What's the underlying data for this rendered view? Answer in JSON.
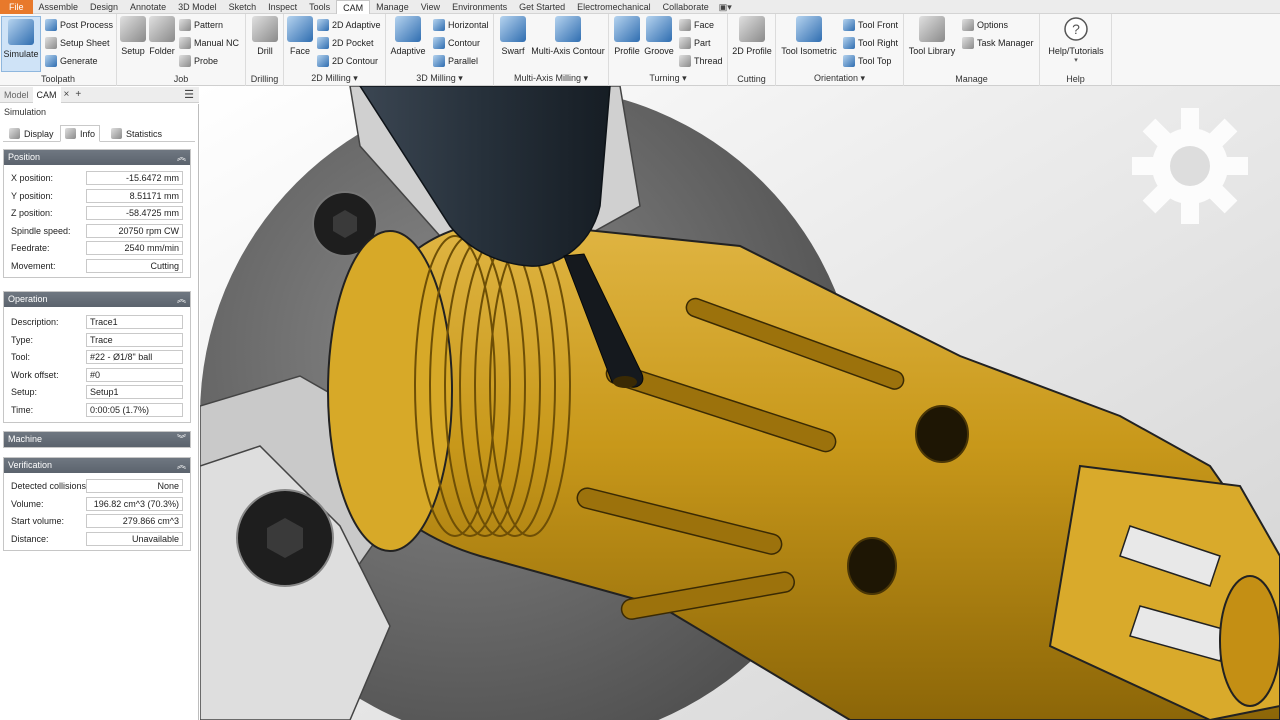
{
  "menu_tabs": [
    "File",
    "Assemble",
    "Design",
    "Annotate",
    "3D Model",
    "Sketch",
    "Inspect",
    "Tools",
    "CAM",
    "Manage",
    "View",
    "Environments",
    "Get Started",
    "Electromechanical",
    "Collaborate"
  ],
  "ribbon": {
    "toolpath": {
      "title": "Toolpath",
      "simulate": "Simulate",
      "post_process": "Post Process",
      "setup_sheet": "Setup Sheet",
      "generate": "Generate"
    },
    "job": {
      "title": "Job",
      "setup": "Setup",
      "folder": "Folder",
      "pattern": "Pattern",
      "manual_nc": "Manual NC",
      "probe": "Probe"
    },
    "drilling": {
      "title": "Drilling",
      "drill": "Drill"
    },
    "milling_2d": {
      "title": "2D Milling",
      "face": "Face",
      "adaptive": "2D Adaptive",
      "pocket": "2D Pocket",
      "contour": "2D Contour"
    },
    "milling_3d": {
      "title": "3D Milling",
      "adaptive": "Adaptive",
      "horizontal": "Horizontal",
      "contour": "Contour",
      "parallel": "Parallel"
    },
    "multi_axis": {
      "title": "Multi-Axis Milling",
      "swarf": "Swarf",
      "multi_axis_contour": "Multi-Axis Contour"
    },
    "turning": {
      "title": "Turning",
      "profile": "Profile",
      "groove": "Groove",
      "face": "Face",
      "part": "Part",
      "thread": "Thread"
    },
    "cutting": {
      "title": "Cutting",
      "profile_2d": "2D Profile"
    },
    "orientation": {
      "title": "Orientation",
      "tool_isometric": "Tool Isometric",
      "tool_front": "Tool Front",
      "tool_right": "Tool Right",
      "tool_top": "Tool Top"
    },
    "manage": {
      "title": "Manage",
      "tool_library": "Tool Library",
      "options": "Options",
      "task_manager": "Task Manager"
    },
    "help": {
      "title": "Help",
      "help_tutorials": "Help/Tutorials"
    }
  },
  "browser": {
    "tab_model": "Model",
    "tab_cam": "CAM",
    "close": "×",
    "add": "+"
  },
  "panel": {
    "title": "Simulation",
    "tabs": {
      "display": "Display",
      "info": "Info",
      "statistics": "Statistics"
    },
    "position": {
      "header": "Position",
      "rows": [
        {
          "label": "X position:",
          "value": "-15.6472 mm"
        },
        {
          "label": "Y position:",
          "value": "8.51171 mm"
        },
        {
          "label": "Z position:",
          "value": "-58.4725 mm"
        },
        {
          "label": "Spindle speed:",
          "value": "20750 rpm CW"
        },
        {
          "label": "Feedrate:",
          "value": "2540 mm/min"
        },
        {
          "label": "Movement:",
          "value": "Cutting"
        }
      ]
    },
    "operation": {
      "header": "Operation",
      "rows": [
        {
          "label": "Description:",
          "value": "Trace1"
        },
        {
          "label": "Type:",
          "value": "Trace"
        },
        {
          "label": "Tool:",
          "value": "#22 - Ø1/8\" ball"
        },
        {
          "label": "Work offset:",
          "value": "#0"
        },
        {
          "label": "Setup:",
          "value": "Setup1"
        },
        {
          "label": "Time:",
          "value": "0:00:05 (1.7%)"
        }
      ]
    },
    "machine": {
      "header": "Machine"
    },
    "verification": {
      "header": "Verification",
      "rows": [
        {
          "label": "Detected collisions:",
          "value": "None"
        },
        {
          "label": "Volume:",
          "value": "196.82 cm^3 (70.3%)"
        },
        {
          "label": "Start volume:",
          "value": "279.866 cm^3"
        },
        {
          "label": "Distance:",
          "value": "Unavailable"
        }
      ]
    }
  },
  "colors": {
    "accent_file": "#e8792b",
    "part_gold": "#c8981a",
    "section_header": "#646c76"
  }
}
